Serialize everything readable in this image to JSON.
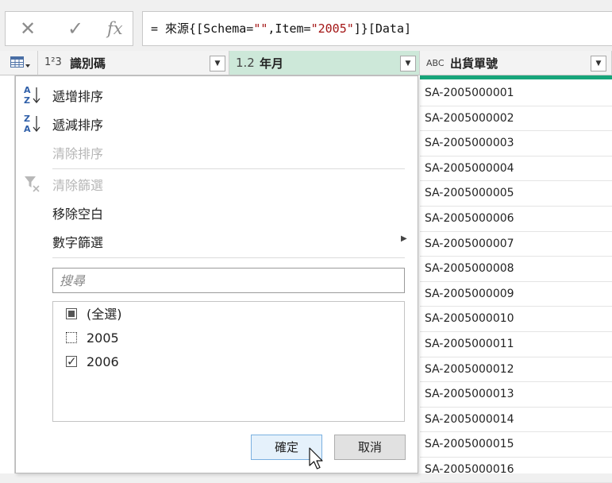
{
  "formula_bar": {
    "cancel_icon": "close-icon",
    "confirm_icon": "check-icon",
    "fx_label": "fx",
    "formula_prefix": "= 來源{[Schema=",
    "formula_str1": "\"\"",
    "formula_mid": ",Item=",
    "formula_str2": "\"2005\"",
    "formula_suffix": "]}[Data]"
  },
  "columns": [
    {
      "type_icon": "1²3",
      "title": "識別碼"
    },
    {
      "type_icon": "1.2",
      "title": "年月"
    },
    {
      "type_icon": "ABC",
      "title": "出貨單號"
    }
  ],
  "table_menu_icon": "table-icon",
  "rows": [
    "SA-2005000001",
    "SA-2005000002",
    "SA-2005000003",
    "SA-2005000004",
    "SA-2005000005",
    "SA-2005000006",
    "SA-2005000007",
    "SA-2005000008",
    "SA-2005000009",
    "SA-2005000010",
    "SA-2005000011",
    "SA-2005000012",
    "SA-2005000013",
    "SA-2005000014",
    "SA-2005000015",
    "SA-2005000016"
  ],
  "filter_menu": {
    "sort_asc": "遞增排序",
    "sort_desc": "遞減排序",
    "clear_sort": "清除排序",
    "clear_filter": "清除篩選",
    "remove_empty": "移除空白",
    "number_filter": "數字篩選",
    "search_placeholder": "搜尋",
    "items": [
      {
        "label": "(全選)",
        "state": "partial"
      },
      {
        "label": "2005",
        "state": "unchecked"
      },
      {
        "label": "2006",
        "state": "checked"
      }
    ],
    "ok_label": "確定",
    "cancel_label": "取消"
  }
}
